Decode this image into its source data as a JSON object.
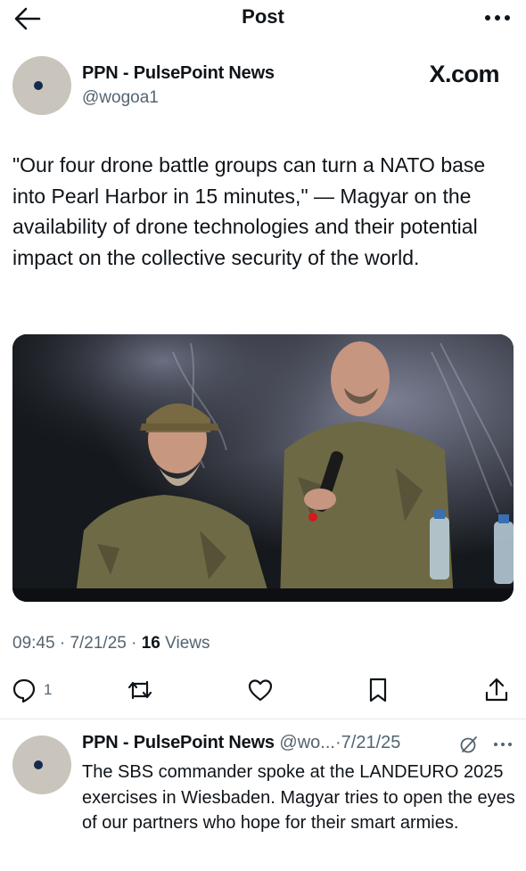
{
  "header": {
    "title": "Post",
    "back_icon": "arrow-left-icon",
    "more_icon": "more-horizontal-icon"
  },
  "post": {
    "author_name": "PPN - PulsePoint News",
    "handle": "@wogoa1",
    "watermark": "X.com",
    "text": "\"Our four drone battle groups can turn a NATO base into Pearl Harbor in 15 minutes,\" — Magyar on the availability of drone technologies and their potential impact on the collective security of the world.",
    "time": "09:45",
    "date": "7/21/25",
    "separator": "·",
    "views_count": "16",
    "views_label": "Views"
  },
  "actions": {
    "reply_count": "1",
    "icons": [
      "reply-icon",
      "repost-icon",
      "like-icon",
      "bookmark-icon",
      "share-icon"
    ]
  },
  "reply": {
    "author_name": "PPN - PulsePoint News",
    "handle_truncated": "@wo...",
    "date": "7/21/25",
    "text": "The SBS commander spoke at the LANDEURO 2025 exercises in Wiesbaden. Magyar tries to open the eyes of our partners who hope for their smart armies."
  },
  "colors": {
    "text": "#0f1419",
    "secondary": "#536471",
    "background": "#ffffff",
    "avatar": "#c9c5bc",
    "avatar_dot": "#142a4f"
  }
}
